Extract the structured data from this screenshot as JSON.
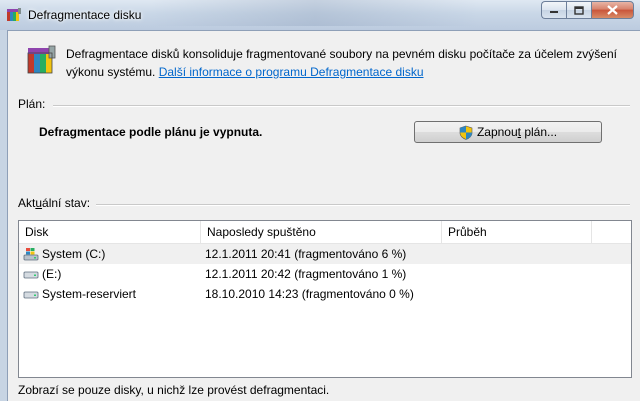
{
  "window": {
    "title": "Defragmentace disku"
  },
  "header": {
    "description": "Defragmentace disků konsoliduje fragmentované soubory na pevném disku počítače za účelem zvýšení výkonu systému.",
    "link": "Další informace o programu Defragmentace disku"
  },
  "schedule": {
    "label": "Plán:",
    "status": "Defragmentace podle plánu je vypnuta.",
    "button_pre": "Zapnou",
    "button_accel": "t",
    "button_post": " plán..."
  },
  "current": {
    "label_pre": "Akt",
    "label_accel": "u",
    "label_post": "ální stav:"
  },
  "table": {
    "columns": [
      "Disk",
      "Naposledy spuštěno",
      "Průběh"
    ],
    "rows": [
      {
        "disk": "System (C:)",
        "last_run": "12.1.2011 20:41 (fragmentováno 6 %)",
        "progress": "",
        "icon": "system-drive-icon"
      },
      {
        "disk": "(E:)",
        "last_run": "12.1.2011 20:42 (fragmentováno 1 %)",
        "progress": "",
        "icon": "drive-icon"
      },
      {
        "disk": "System-reserviert",
        "last_run": "18.10.2010 14:23 (fragmentováno 0 %)",
        "progress": "",
        "icon": "drive-icon"
      }
    ]
  },
  "footer": {
    "note": "Zobrazí se pouze disky, u nichž lze provést defragmentaci."
  },
  "colors": {
    "link": "#0066cc",
    "titlebar": "#c9d7e7",
    "close_button": "#c9553a",
    "selected_row": "#f0f0f0"
  }
}
